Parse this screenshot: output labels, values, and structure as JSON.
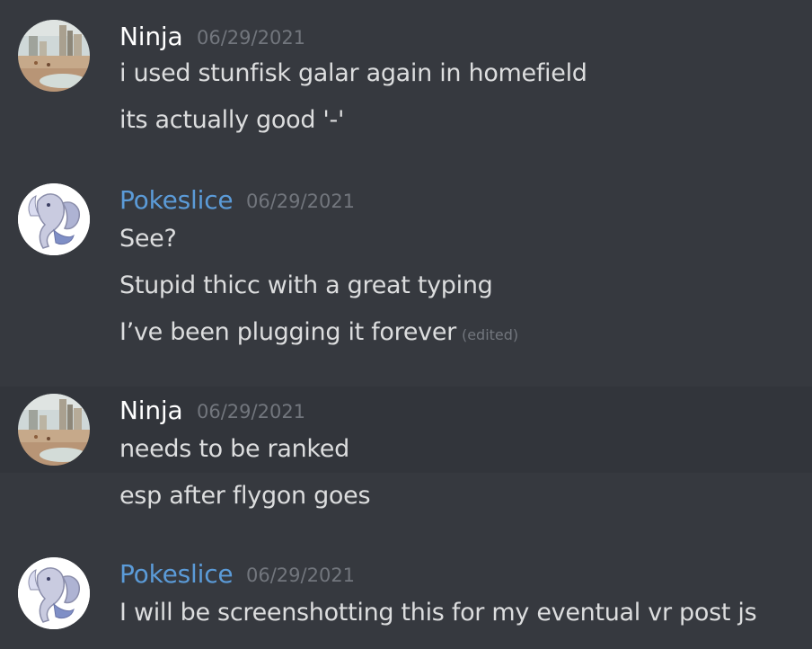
{
  "colors": {
    "background": "#36393f",
    "hover_background": "#32353b",
    "text": "#dcddde",
    "timestamp": "#72767d",
    "author_default": "#ffffff",
    "author_role": "#5b9bd8"
  },
  "messages": [
    {
      "author": "Ninja",
      "author_color": "#ffffff",
      "timestamp": "06/29/2021",
      "avatar_icon": "beach-photo-avatar",
      "lines": [
        "i used stunfisk galar again in homefield",
        "its actually good '-'"
      ]
    },
    {
      "author": "Pokeslice",
      "author_color": "#5b9bd8",
      "timestamp": "06/29/2021",
      "avatar_icon": "lugia-avatar",
      "lines": [
        "See?",
        "Stupid thicc with a great typing",
        "I’ve been plugging it forever"
      ],
      "edited_label": "(edited)"
    },
    {
      "author": "Ninja",
      "author_color": "#ffffff",
      "timestamp": "06/29/2021",
      "avatar_icon": "beach-photo-avatar",
      "lines": [
        "needs to be ranked",
        "esp after flygon goes"
      ]
    },
    {
      "author": "Pokeslice",
      "author_color": "#5b9bd8",
      "timestamp": "06/29/2021",
      "avatar_icon": "lugia-avatar",
      "lines": [
        "I will be screenshotting this for my eventual vr post js"
      ]
    }
  ]
}
